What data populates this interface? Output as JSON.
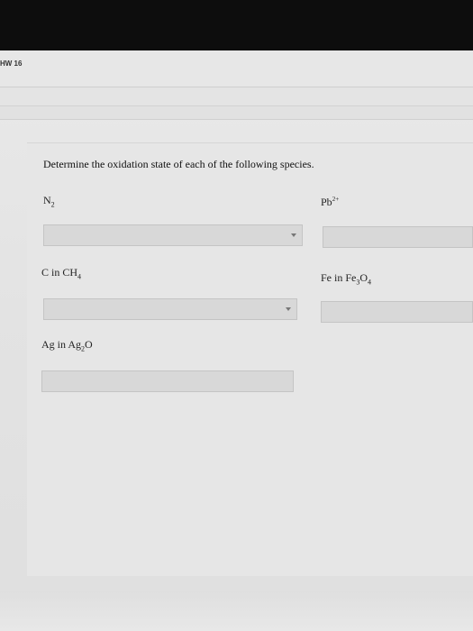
{
  "header": {
    "assignment_label": "HW 16"
  },
  "question": {
    "prompt": "Determine the oxidation state of each of the following species."
  },
  "items": [
    {
      "label_main": "N",
      "label_sub": "2",
      "label_tail": "",
      "label_sup": "",
      "value": ""
    },
    {
      "label_main": "Pb",
      "label_sub": "",
      "label_tail": "",
      "label_sup": "2+",
      "value": ""
    },
    {
      "label_main": "C in CH",
      "label_sub": "4",
      "label_tail": "",
      "label_sup": "",
      "value": ""
    },
    {
      "label_main": "Fe in Fe",
      "label_sub": "3",
      "label_tail": "O",
      "label_sub2": "4",
      "value": ""
    },
    {
      "label_main": "Ag in Ag",
      "label_sub": "2",
      "label_tail": "O",
      "label_sup": "",
      "value": ""
    }
  ]
}
